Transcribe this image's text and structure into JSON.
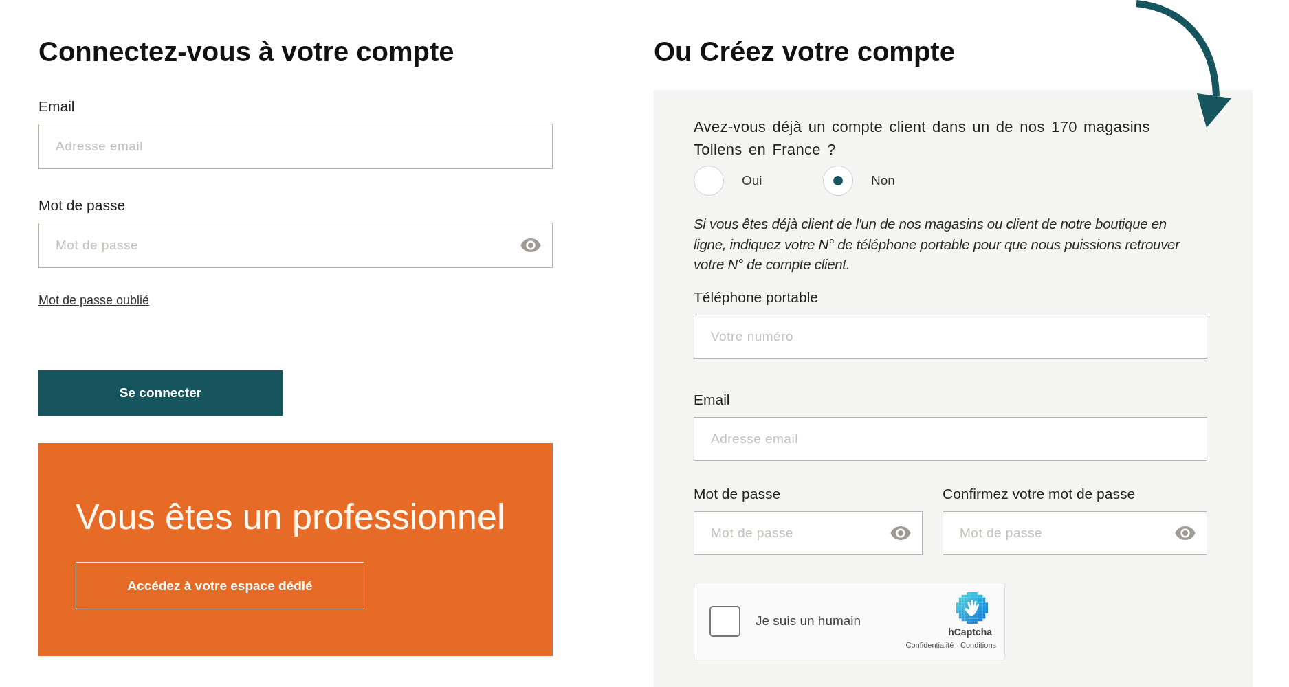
{
  "login": {
    "title": "Connectez-vous à votre compte",
    "email": {
      "label": "Email",
      "placeholder": "Adresse email"
    },
    "password": {
      "label": "Mot de passe",
      "placeholder": "Mot de passe"
    },
    "forgot_link": "Mot de passe oublié",
    "submit_button": "Se connecter"
  },
  "pro_banner": {
    "title": "Vous êtes un professionnel",
    "button": "Accédez à votre espace dédié"
  },
  "signup": {
    "title": "Ou Créez votre compte",
    "question": "Avez-vous déjà un compte client dans un de nos 170 magasins Tollens en France ?",
    "options": [
      {
        "label": "Oui",
        "selected": false
      },
      {
        "label": "Non",
        "selected": true
      }
    ],
    "note": "Si vous êtes déjà client de l'un de nos magasins ou client de notre boutique en ligne, indiquez votre N° de téléphone portable pour que nous puissions retrouver votre N° de compte client.",
    "phone": {
      "label": "Téléphone portable",
      "placeholder": "Votre numéro"
    },
    "email": {
      "label": "Email",
      "placeholder": "Adresse email"
    },
    "password": {
      "label": "Mot de passe",
      "placeholder": "Mot de passe"
    },
    "confirm_password": {
      "label": "Confirmez votre mot de passe",
      "placeholder": "Mot de passe"
    },
    "captcha": {
      "label": "Je suis un humain",
      "checked": false,
      "brand": "hCaptcha",
      "legal": "Confidentialité - Conditions"
    }
  }
}
